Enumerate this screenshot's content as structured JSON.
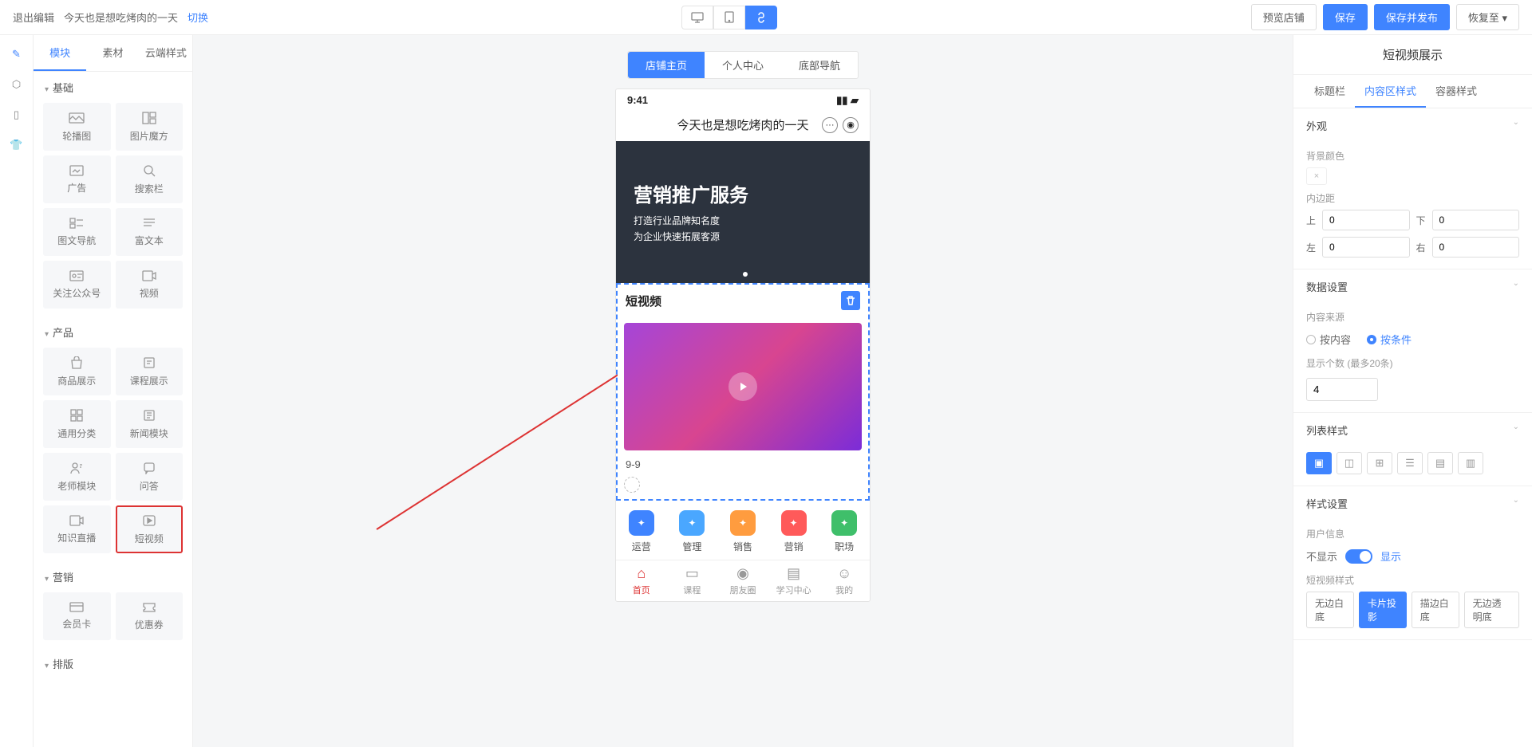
{
  "topbar": {
    "exit": "退出编辑",
    "shop": "今天也是想吃烤肉的一天",
    "switch": "切换",
    "preview": "预览店铺",
    "save": "保存",
    "publish": "保存并发布",
    "restore": "恢复至"
  },
  "left_tabs": {
    "modules": "模块",
    "assets": "素材",
    "cloud": "云端样式"
  },
  "sections": {
    "basic": "基础",
    "product": "产品",
    "marketing": "营销",
    "layout": "排版"
  },
  "modules": {
    "carousel": "轮播图",
    "imgcube": "图片魔方",
    "ad": "广告",
    "search": "搜索栏",
    "navtext": "图文导航",
    "richtext": "富文本",
    "follow": "关注公众号",
    "video": "视频",
    "goods": "商品展示",
    "course": "课程展示",
    "category": "通用分类",
    "news": "新闻模块",
    "teacher": "老师模块",
    "qa": "问答",
    "live": "知识直播",
    "shortvideo": "短视频",
    "membercard": "会员卡",
    "coupon": "优惠券"
  },
  "canvas_tabs": {
    "home": "店铺主页",
    "mine": "个人中心",
    "bottom": "底部导航"
  },
  "phone": {
    "time": "9:41",
    "title": "今天也是想吃烤肉的一天",
    "banner_h": "营销推广服务",
    "banner_l1": "打造行业品牌知名度",
    "banner_l2": "为企业快速拓展客源",
    "sv_head": "短视频",
    "sv_item": "9-9",
    "cats": [
      {
        "label": "运营",
        "color": "#3f84ff"
      },
      {
        "label": "管理",
        "color": "#4aa7ff"
      },
      {
        "label": "销售",
        "color": "#ff9c3f"
      },
      {
        "label": "营销",
        "color": "#ff5a5a"
      },
      {
        "label": "职场",
        "color": "#3fbf6a"
      }
    ],
    "tabs": [
      {
        "label": "首页",
        "active": true
      },
      {
        "label": "课程"
      },
      {
        "label": "朋友圈"
      },
      {
        "label": "学习中心"
      },
      {
        "label": "我的"
      }
    ]
  },
  "rp": {
    "title": "短视频展示",
    "tabs": {
      "titlebar": "标题栏",
      "content": "内容区样式",
      "container": "容器样式"
    },
    "appearance": {
      "head": "外观",
      "bg_label": "背景颜色",
      "pad_label": "内边距",
      "top": "上",
      "bottom": "下",
      "left": "左",
      "right": "右",
      "vals": {
        "top": "0",
        "bottom": "0",
        "left": "0",
        "right": "0"
      }
    },
    "data": {
      "head": "数据设置",
      "src_label": "内容来源",
      "by_content": "按内容",
      "by_cond": "按条件",
      "count_label": "显示个数 (最多20条)",
      "count_val": "4"
    },
    "list": {
      "head": "列表样式"
    },
    "style": {
      "head": "样式设置",
      "user_label": "用户信息",
      "hide": "不显示",
      "show": "显示",
      "fmt_label": "短视频样式",
      "chips": [
        "无边白底",
        "卡片投影",
        "描边白底",
        "无边透明底"
      ]
    }
  }
}
